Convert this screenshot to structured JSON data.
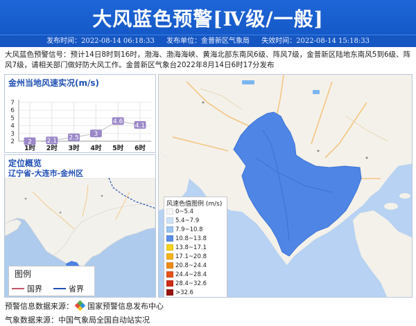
{
  "header": {
    "title": "大风蓝色预警[Ⅳ级/一般]",
    "publish_time": "发布时间：2022-08-14 06:18:33",
    "publisher": "发布单位：金普新区气象局",
    "expire_time": "失效时间：2022-08-14 15:18:33"
  },
  "warning_text": "大风蓝色预警信号：预计14日8时到16时，渤海、渤海海峡、黄海北部东南风6级、阵风7级，金普新区陆地东南风5到6级、阵风7级，请相关部门做好防大风工作。金普新区气象台2022年8月14日6时17分发布",
  "wind_panel": {
    "title": "金州当地风速实况(m/s)"
  },
  "location_panel": {
    "title": "定位概览",
    "region": "辽宁省-大连市-金州区",
    "legend_title": "图例",
    "legend_items": [
      {
        "label": "国界",
        "color": "#c2566b"
      },
      {
        "label": "省界",
        "color": "#1f4fb4"
      }
    ]
  },
  "wind_legend": {
    "title": "风速色值图例 (m/s)",
    "items": [
      {
        "label": "0~5.4",
        "color": "#f7f7f7"
      },
      {
        "label": "5.4~7.9",
        "color": "#cfe3f7"
      },
      {
        "label": "7.9~10.8",
        "color": "#9dc5f2"
      },
      {
        "label": "10.8~13.8",
        "color": "#5a8fe8"
      },
      {
        "label": "13.8~17.1",
        "color": "#f5d21b"
      },
      {
        "label": "17.1~20.8",
        "color": "#f3b21c"
      },
      {
        "label": "20.8~24.4",
        "color": "#ee8a19"
      },
      {
        "label": "24.4~28.4",
        "color": "#e6511b"
      },
      {
        "label": "28.4~32.6",
        "color": "#cf2a17"
      },
      {
        "label": ">32.6",
        "color": "#96130f"
      }
    ]
  },
  "sources": {
    "warning": "预警信息数据来源：",
    "warning_org": "国家预警信息发布中心",
    "weather": "气象数据来源：中国气象局全国自动站实况"
  },
  "chart_data": {
    "type": "line",
    "categories": [
      "1时",
      "2时",
      "3时",
      "4时",
      "5时",
      "6时"
    ],
    "values": [
      2,
      2.1,
      2.5,
      3,
      4.6,
      4.1
    ],
    "data_labels": [
      "2",
      "2.1",
      "2.5",
      "3",
      "4.6",
      "4.1"
    ],
    "y_ticks": [
      "2",
      "3",
      "4",
      "5",
      "6",
      "7"
    ],
    "ylim": [
      2,
      7
    ],
    "grid": true,
    "title": "金州当地风速实况(m/s)",
    "label_color": "#9b88c9"
  }
}
